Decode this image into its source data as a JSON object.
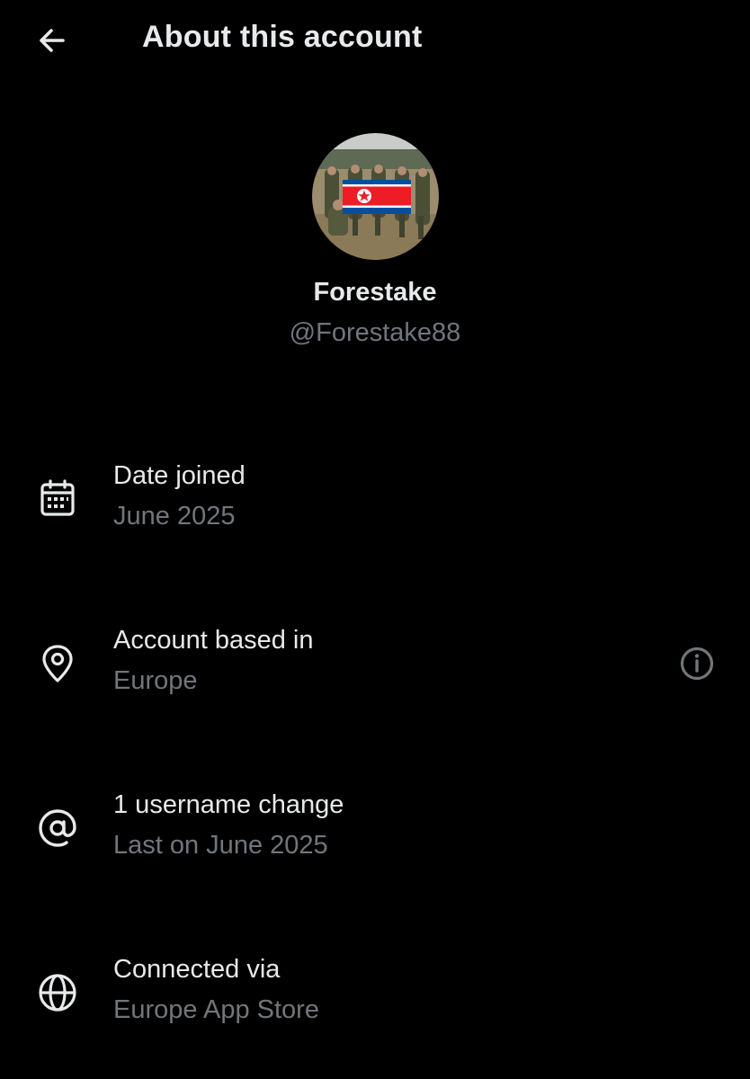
{
  "header": {
    "back_icon": "arrow-left-icon",
    "title": "About this account"
  },
  "profile": {
    "avatar_description": "profile-photo",
    "display_name": "Forestake",
    "handle": "@Forestake88"
  },
  "rows": [
    {
      "icon": "calendar-icon",
      "title": "Date joined",
      "subtitle": "June 2025"
    },
    {
      "icon": "location-pin-icon",
      "title": "Account based in",
      "subtitle": "Europe",
      "trailing_icon": "info-icon"
    },
    {
      "icon": "at-sign-icon",
      "title": "1 username change",
      "subtitle": "Last on June 2025"
    },
    {
      "icon": "globe-icon",
      "title": "Connected via",
      "subtitle": "Europe App Store"
    }
  ],
  "colors": {
    "background": "#000000",
    "primary_text": "#e7e9ea",
    "secondary_text": "#71767b",
    "flag_red": "#ed1c27",
    "flag_blue": "#024fa2"
  }
}
